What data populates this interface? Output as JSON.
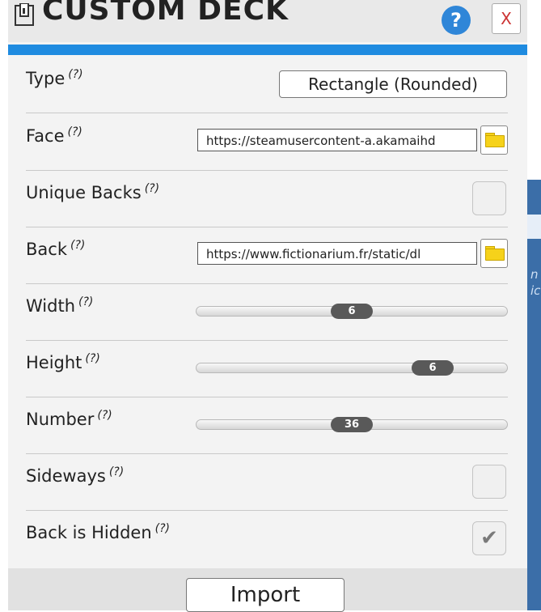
{
  "dialog": {
    "title": "CUSTOM DECK",
    "help_label": "?",
    "close_label": "X",
    "accent_color": "#1f8be0"
  },
  "help_marker": "(?)",
  "fields": {
    "type": {
      "label": "Type",
      "value": "Rectangle (Rounded)"
    },
    "face": {
      "label": "Face",
      "value": "https://steamusercontent-a.akamaihd"
    },
    "unique_backs": {
      "label": "Unique Backs",
      "checked": false
    },
    "back": {
      "label": "Back",
      "value": "https://www.fictionarium.fr/static/dl"
    },
    "width": {
      "label": "Width",
      "value": "6"
    },
    "height": {
      "label": "Height",
      "value": "6"
    },
    "number": {
      "label": "Number",
      "value": "36"
    },
    "sideways": {
      "label": "Sideways",
      "checked": false
    },
    "back_is_hidden": {
      "label": "Back is Hidden",
      "checked": true
    }
  },
  "footer": {
    "import_label": "Import"
  },
  "icons": [
    "cards-icon",
    "help-icon",
    "close-icon",
    "folder-icon",
    "checkmark-icon"
  ]
}
